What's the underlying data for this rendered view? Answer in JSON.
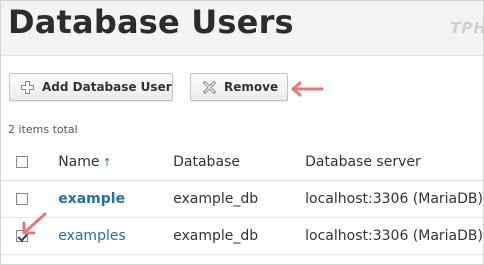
{
  "page": {
    "title": "Database Users",
    "watermark": "TPH"
  },
  "toolbar": {
    "add_label": "Add Database User",
    "add_icon": "plus-icon",
    "remove_label": "Remove",
    "remove_icon": "x-icon",
    "annotation_color": "#e8777a"
  },
  "list": {
    "items_total": "2 items total",
    "headers": {
      "name": "Name",
      "sort_indicator": "↑",
      "database": "Database",
      "server": "Database server"
    },
    "rows": [
      {
        "name": "example",
        "database": "example_db",
        "server": "localhost:3306 (MariaDB)",
        "checked": false
      },
      {
        "name": "examples",
        "database": "example_db",
        "server": "localhost:3306 (MariaDB)",
        "checked": true
      }
    ]
  },
  "colors": {
    "link": "#1f6fb2",
    "title_bar": "#f3f3f3",
    "annotation_arrow": "#e8777a"
  }
}
